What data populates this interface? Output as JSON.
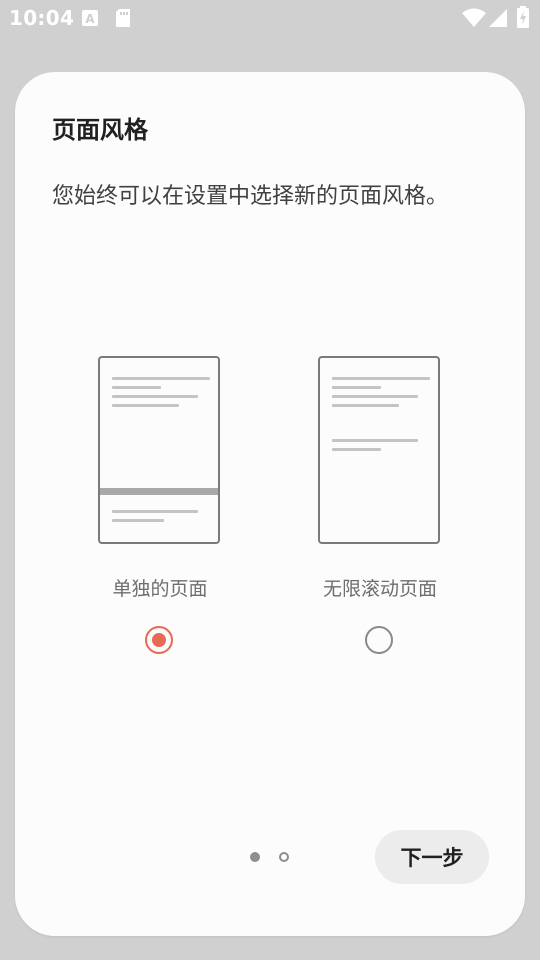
{
  "status_bar": {
    "time": "10:04"
  },
  "dialog": {
    "title": "页面风格",
    "description": "您始终可以在设置中选择新的页面风格。",
    "options": [
      {
        "label": "单独的页面",
        "selected": true
      },
      {
        "label": "无限滚动页面",
        "selected": false
      }
    ],
    "pager": {
      "page": 1,
      "total": 2
    },
    "next_label": "下一步"
  },
  "colors": {
    "accent": "#e86a55",
    "card": "#fcfcfc",
    "backdrop": "#d0d0d0"
  }
}
